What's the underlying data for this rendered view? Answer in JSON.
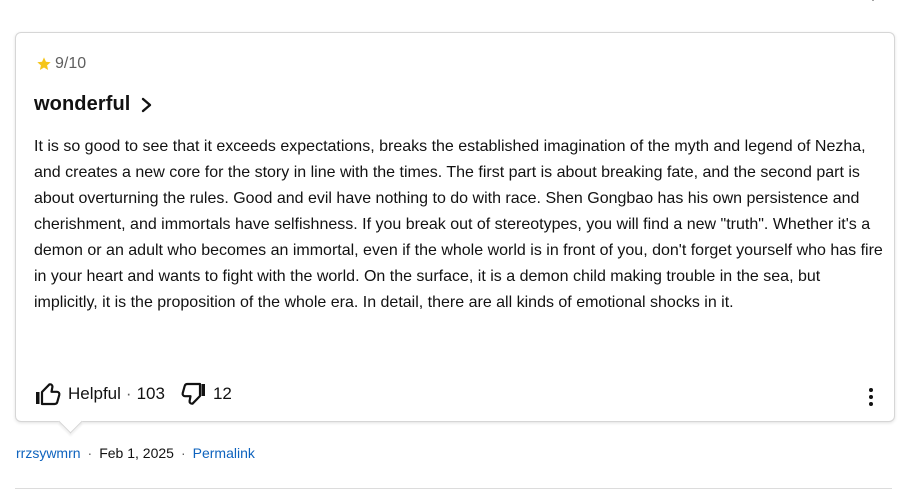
{
  "review": {
    "rating": {
      "score": "9",
      "max": "/10",
      "star_color": "#f5c518"
    },
    "title": "wonderful",
    "body": "It is so good to see that it exceeds expectations, breaks the established imagination of the myth and legend of Nezha, and creates a new core for the story in line with the times. The first part is about breaking fate, and the second part is about overturning the rules. Good and evil have nothing to do with race. Shen Gongbao has his own persistence and cherishment, and immortals have selfishness. If you break out of stereotypes, you will find a new \"truth\". Whether it's a demon or an adult who becomes an immortal, even if the whole world is in front of you, don't forget yourself who has fire in your heart and wants to fight with the world. On the surface, it is a demon child making trouble in the sea, but implicitly, it is the proposition of the whole era. In detail, there are all kinds of emotional shocks in it.",
    "actions": {
      "helpful_label": "Helpful",
      "separator": "·",
      "helpful_count": "103",
      "unhelpful_count": "12"
    },
    "icons": {
      "star": "star-icon",
      "title_chevron": "chevron-right-icon",
      "helpful": "thumbs-up-icon",
      "unhelpful": "thumbs-down-icon",
      "more": "more-options-icon"
    }
  },
  "meta": {
    "author": "rrzsywmrn",
    "separator": "·",
    "date": "Feb 1, 2025",
    "permalink_label": "Permalink",
    "link_color": "#0e63be"
  }
}
